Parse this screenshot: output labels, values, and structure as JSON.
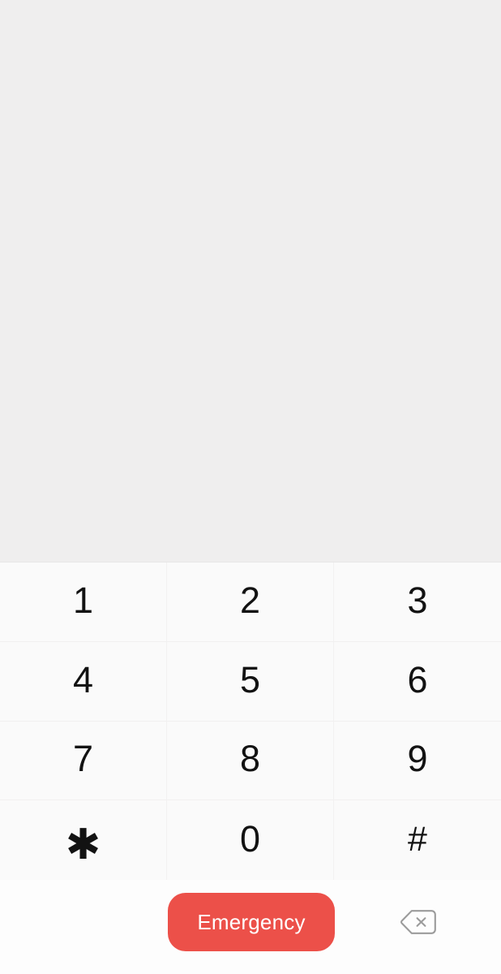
{
  "screen": {
    "name": "phone-dialer",
    "background_color": "#ffffff"
  },
  "display": {
    "dialed_number": "",
    "placeholder": "",
    "background_color": "#efeeee"
  },
  "keypad": {
    "background_color": "#fafafa",
    "columns": 3,
    "rows": 4,
    "keys": [
      {
        "label": "1",
        "name": "key-1",
        "kind": "digit"
      },
      {
        "label": "2",
        "name": "key-2",
        "kind": "digit"
      },
      {
        "label": "3",
        "name": "key-3",
        "kind": "digit"
      },
      {
        "label": "4",
        "name": "key-4",
        "kind": "digit"
      },
      {
        "label": "5",
        "name": "key-5",
        "kind": "digit"
      },
      {
        "label": "6",
        "name": "key-6",
        "kind": "digit"
      },
      {
        "label": "7",
        "name": "key-7",
        "kind": "digit"
      },
      {
        "label": "8",
        "name": "key-8",
        "kind": "digit"
      },
      {
        "label": "9",
        "name": "key-9",
        "kind": "digit"
      },
      {
        "label": "✱",
        "name": "key-star",
        "kind": "symbol"
      },
      {
        "label": "0",
        "name": "key-0",
        "kind": "digit"
      },
      {
        "label": "#",
        "name": "key-hash",
        "kind": "symbol"
      }
    ]
  },
  "action_bar": {
    "emergency": {
      "label": "Emergency",
      "background_color": "#ec5049",
      "text_color": "#ffffff"
    },
    "backspace": {
      "icon": "backspace-delete-icon",
      "icon_color": "#9b9b9b",
      "label": ""
    }
  },
  "colors": {
    "display_background": "#efeeee",
    "keypad_background": "#fafafa",
    "key_text": "#121212",
    "divider": "#f2f1f1",
    "accent_red": "#ec5049",
    "icon_gray": "#9b9b9b"
  }
}
